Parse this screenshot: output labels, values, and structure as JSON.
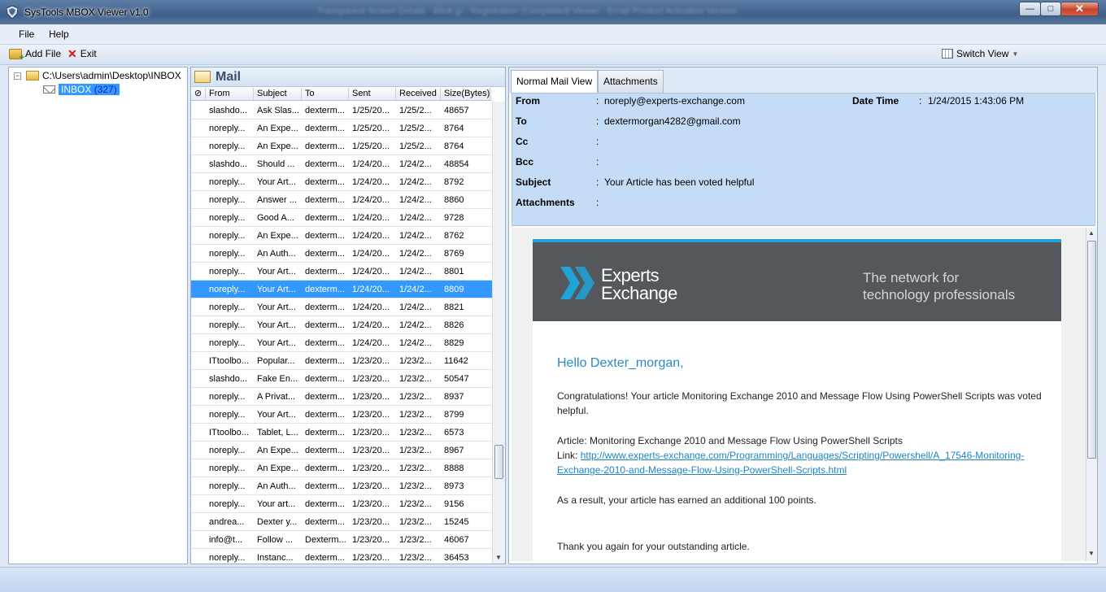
{
  "window": {
    "title": "SysTools MBOX Viewer v1.0",
    "blurred_title": "Transparent Screen Details · Blink.jp · Registration (Completed) Viewer · Email Product Activation Version",
    "controls": {
      "minimize": "—",
      "maximize": "□",
      "close": "✕"
    }
  },
  "menu": {
    "file": "File",
    "help": "Help"
  },
  "toolbar": {
    "add_file": "Add File",
    "exit": "Exit",
    "switch_view": "Switch View"
  },
  "tree": {
    "root_path": "C:\\Users\\admin\\Desktop\\INBOX",
    "inbox_label": "INBOX",
    "inbox_count": "(327)"
  },
  "mail_list": {
    "title": "Mail",
    "columns": [
      "From",
      "Subject",
      "To",
      "Sent",
      "Received",
      "Size(Bytes)"
    ],
    "rows": [
      {
        "from": "slashdo...",
        "subject": "Ask Slas...",
        "to": "dexterm...",
        "sent": "1/25/20...",
        "received": "1/25/2...",
        "size": "48657"
      },
      {
        "from": "noreply...",
        "subject": "An Expe...",
        "to": "dexterm...",
        "sent": "1/25/20...",
        "received": "1/25/2...",
        "size": "8764"
      },
      {
        "from": "noreply...",
        "subject": "An Expe...",
        "to": "dexterm...",
        "sent": "1/25/20...",
        "received": "1/25/2...",
        "size": "8764"
      },
      {
        "from": "slashdo...",
        "subject": "Should ...",
        "to": "dexterm...",
        "sent": "1/24/20...",
        "received": "1/24/2...",
        "size": "48854"
      },
      {
        "from": "noreply...",
        "subject": "Your Art...",
        "to": "dexterm...",
        "sent": "1/24/20...",
        "received": "1/24/2...",
        "size": "8792"
      },
      {
        "from": "noreply...",
        "subject": "Answer ...",
        "to": "dexterm...",
        "sent": "1/24/20...",
        "received": "1/24/2...",
        "size": "8860"
      },
      {
        "from": "noreply...",
        "subject": "Good A...",
        "to": "dexterm...",
        "sent": "1/24/20...",
        "received": "1/24/2...",
        "size": "9728"
      },
      {
        "from": "noreply...",
        "subject": "An Expe...",
        "to": "dexterm...",
        "sent": "1/24/20...",
        "received": "1/24/2...",
        "size": "8762"
      },
      {
        "from": "noreply...",
        "subject": "An Auth...",
        "to": "dexterm...",
        "sent": "1/24/20...",
        "received": "1/24/2...",
        "size": "8769"
      },
      {
        "from": "noreply...",
        "subject": "Your Art...",
        "to": "dexterm...",
        "sent": "1/24/20...",
        "received": "1/24/2...",
        "size": "8801"
      },
      {
        "from": "noreply...",
        "subject": "Your Art...",
        "to": "dexterm...",
        "sent": "1/24/20...",
        "received": "1/24/2...",
        "size": "8809",
        "selected": true
      },
      {
        "from": "noreply...",
        "subject": "Your Art...",
        "to": "dexterm...",
        "sent": "1/24/20...",
        "received": "1/24/2...",
        "size": "8821"
      },
      {
        "from": "noreply...",
        "subject": "Your Art...",
        "to": "dexterm...",
        "sent": "1/24/20...",
        "received": "1/24/2...",
        "size": "8826"
      },
      {
        "from": "noreply...",
        "subject": "Your Art...",
        "to": "dexterm...",
        "sent": "1/24/20...",
        "received": "1/24/2...",
        "size": "8829"
      },
      {
        "from": "ITtoolbo...",
        "subject": "Popular...",
        "to": "dexterm...",
        "sent": "1/23/20...",
        "received": "1/23/2...",
        "size": "11642"
      },
      {
        "from": "slashdo...",
        "subject": "Fake En...",
        "to": "dexterm...",
        "sent": "1/23/20...",
        "received": "1/23/2...",
        "size": "50547"
      },
      {
        "from": "noreply...",
        "subject": "A Privat...",
        "to": "dexterm...",
        "sent": "1/23/20...",
        "received": "1/23/2...",
        "size": "8937"
      },
      {
        "from": "noreply...",
        "subject": "Your Art...",
        "to": "dexterm...",
        "sent": "1/23/20...",
        "received": "1/23/2...",
        "size": "8799"
      },
      {
        "from": "ITtoolbo...",
        "subject": "Tablet, L...",
        "to": "dexterm...",
        "sent": "1/23/20...",
        "received": "1/23/2...",
        "size": "6573"
      },
      {
        "from": "noreply...",
        "subject": "An Expe...",
        "to": "dexterm...",
        "sent": "1/23/20...",
        "received": "1/23/2...",
        "size": "8967"
      },
      {
        "from": "noreply...",
        "subject": "An Expe...",
        "to": "dexterm...",
        "sent": "1/23/20...",
        "received": "1/23/2...",
        "size": "8888"
      },
      {
        "from": "noreply...",
        "subject": "An Auth...",
        "to": "dexterm...",
        "sent": "1/23/20...",
        "received": "1/23/2...",
        "size": "8973"
      },
      {
        "from": "noreply...",
        "subject": "Your art...",
        "to": "dexterm...",
        "sent": "1/23/20...",
        "received": "1/23/2...",
        "size": "9156"
      },
      {
        "from": "andrea...",
        "subject": "Dexter y...",
        "to": "dexterm...",
        "sent": "1/23/20...",
        "received": "1/23/2...",
        "size": "15245"
      },
      {
        "from": "info@t...",
        "subject": "Follow ...",
        "to": "Dexterm...",
        "sent": "1/23/20...",
        "received": "1/23/2...",
        "size": "46067"
      },
      {
        "from": "noreply...",
        "subject": "Instanc...",
        "to": "dexterm...",
        "sent": "1/23/20...",
        "received": "1/23/2...",
        "size": "36453"
      }
    ]
  },
  "viewer": {
    "tabs": [
      "Normal Mail View",
      "Attachments"
    ],
    "headers": {
      "from_label": "From",
      "from_value": "noreply@experts-exchange.com",
      "to_label": "To",
      "to_value": "dextermorgan4282@gmail.com",
      "cc_label": "Cc",
      "cc_value": "",
      "bcc_label": "Bcc",
      "bcc_value": "",
      "subject_label": "Subject",
      "subject_value": "Your Article has been voted helpful",
      "attachments_label": "Attachments",
      "attachments_value": "",
      "date_label": "Date Time",
      "date_value": "1/24/2015 1:43:06 PM",
      "colon": ":"
    },
    "body": {
      "logo_line1": "Experts",
      "logo_line2": "Exchange",
      "tagline_line1": "The network for",
      "tagline_line2": "technology professionals",
      "greeting": "Hello Dexter_morgan,",
      "congrats": "Congratulations! Your article Monitoring Exchange 2010 and Message Flow Using PowerShell Scripts was voted helpful.",
      "article": "Article: Monitoring Exchange 2010 and Message Flow Using PowerShell Scripts",
      "link_label": "Link: ",
      "link_url": "http://www.experts-exchange.com/Programming/Languages/Scripting/Powershell/A_17546-Monitoring-Exchange-2010-and-Message-Flow-Using-PowerShell-Scripts.html",
      "points": "As a result, your article has earned an additional 100 points.",
      "thanks": "Thank you again for your outstanding article."
    }
  },
  "colors": {
    "selection": "#3399ff",
    "header_bg": "#c5dcf7",
    "banner_bg": "#54575b",
    "banner_accent": "#1fa3d8",
    "link": "#1e84c4"
  }
}
